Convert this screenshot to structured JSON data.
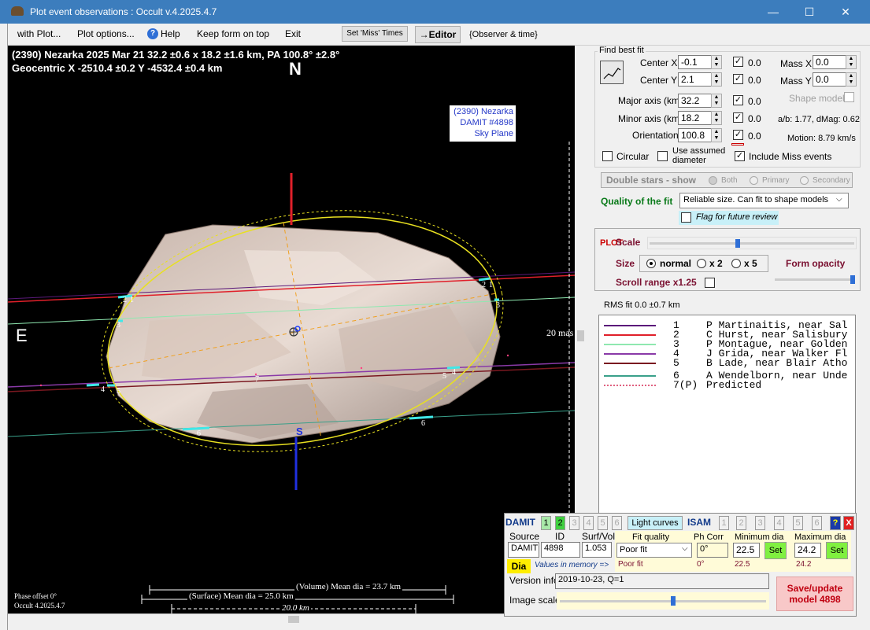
{
  "window": {
    "title": "Plot event observations : Occult v.4.2025.4.7"
  },
  "menu": {
    "with_plot": "with Plot...",
    "plot_options": "Plot options...",
    "help": "Help",
    "keep_on_top": "Keep form on top",
    "exit": "Exit",
    "set_miss_times": "Set 'Miss' Times",
    "editor": "→Editor",
    "observer_time": "{Observer & time}"
  },
  "plot": {
    "header_line1": "(2390) Nezarka  2025 Mar 21   32.2 ±0.6 x 18.2 ±1.6 km, PA 100.8° ±2.8°",
    "header_line2": "Geocentric  X  -2510.4 ±0.2  Y -4532.4 ±0.4 km",
    "north": "N",
    "east": "E",
    "south": "S",
    "box_line1": "(2390) Nezarka",
    "box_line2": "DAMIT #4898",
    "box_line3": "Sky Plane",
    "scale_label": "20 mas",
    "volume_dia": "(Volume) Mean dia = 23.7 km",
    "surface_dia": "(Surface) Mean dia = 25.0 km",
    "km_scale": "20.0 km",
    "phase_offset": "Phase offset 0°",
    "version": "Occult 4.2025.4.7",
    "chord_labels": [
      "1",
      "2",
      "3",
      "4",
      "5",
      "6",
      "7",
      "2",
      "1",
      "3",
      "4",
      "5",
      "6",
      "3",
      "2",
      "1",
      "4",
      "5",
      "6"
    ]
  },
  "fit": {
    "group_title": "Find best fit",
    "center_x_label": "Center X",
    "center_x": "-0.1",
    "center_y_label": "Center Y",
    "center_y": "2.1",
    "major_label": "Major axis (km)",
    "major": "32.2",
    "minor_label": "Minor axis (km)",
    "minor": "18.2",
    "orient_label": "Orientation",
    "orient": "100.8",
    "step_values": [
      "0.0",
      "0.0",
      "0.0",
      "0.0",
      "0.0"
    ],
    "mass_x_label": "Mass X",
    "mass_x": "0.0",
    "mass_y_label": "Mass Y",
    "mass_y": "0.0",
    "shape_model": "Shape model",
    "ab_dmag": "a/b: 1.77, dMag: 0.62",
    "motion": "Motion: 8.79 km/s",
    "circular": "Circular",
    "use_assumed": "Use assumed diameter",
    "include_miss": "Include Miss events",
    "double_stars": "Double stars - show",
    "both": "Both",
    "primary": "Primary",
    "secondary": "Secondary",
    "quality_label": "Quality of the fit",
    "quality_value": "Reliable size. Can fit to shape models",
    "flag_review": "Flag for future review"
  },
  "plotctl": {
    "side_label": "PLOT",
    "scale": "Scale",
    "size": "Size",
    "normal": "normal",
    "x2": "x 2",
    "x5": "x 5",
    "form_opacity": "Form opacity",
    "scroll_range": "Scroll range x1.25",
    "scale_slider": 0.43,
    "opacity_slider": 1.0
  },
  "rms": "RMS fit 0.0 ±0.7 km",
  "legend": [
    {
      "n": "1",
      "text": "P Martinaitis, near Sal",
      "color": "#5b1a7a"
    },
    {
      "n": "2",
      "text": "C Hurst, near Salisbury",
      "color": "#e0202a"
    },
    {
      "n": "3",
      "text": "P Montague, near Golden",
      "color": "#8fe8b0"
    },
    {
      "n": "4",
      "text": "J Grida, near Walker Fl",
      "color": "#8a3aa8"
    },
    {
      "n": "5",
      "text": "B Lade, near Blair Atho",
      "color": "#7a1820"
    },
    {
      "n": "6",
      "text": "A Wendelborn, near Unde",
      "color": "#3aa08a"
    },
    {
      "n": "7(P)",
      "text": "Predicted",
      "color": "#e06080"
    }
  ],
  "damit": {
    "damit_label": "DAMIT",
    "model_nums": [
      "1",
      "2",
      "3",
      "4",
      "5",
      "6"
    ],
    "light_curves": "Light curves",
    "isam_label": "ISAM",
    "isam_nums": [
      "1",
      "2",
      "3",
      "4",
      "5",
      "6"
    ],
    "help": "?",
    "close": "X",
    "source_h": "Source",
    "id_h": "ID",
    "surfvol_h": "Surf/Vol",
    "fitq_h": "Fit quality",
    "phcorr_h": "Ph Corr",
    "mindia_h": "Minimum dia",
    "maxdia_h": "Maximum dia",
    "source": "DAMIT",
    "id": "4898",
    "surfvol": "1.053",
    "fitq": "Poor fit",
    "phcorr": "0°",
    "mindia": "22.5",
    "maxdia": "24.2",
    "set": "Set",
    "dia": "Dia",
    "values_mem": "Values in memory =>",
    "mem_fitq": "Poor fit",
    "mem_ph": "0°",
    "mem_min": "22.5",
    "mem_max": "24.2",
    "version_label": "Version info",
    "version": "2019-10-23, Q=1",
    "image_scale": "Image scale",
    "save_line1": "Save/update",
    "save_line2": "model 4898",
    "image_scale_slider": 0.55
  }
}
